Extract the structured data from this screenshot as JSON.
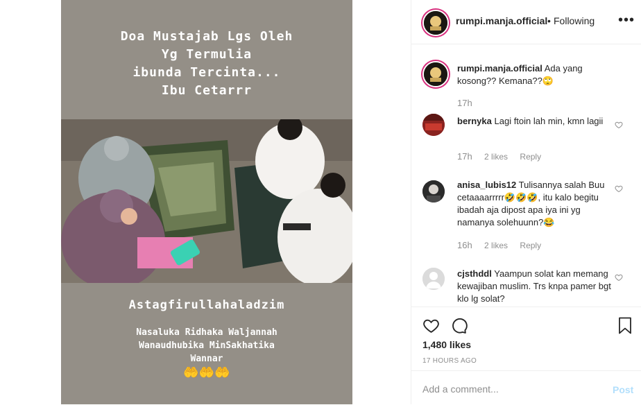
{
  "story": {
    "caption_lines": [
      "Doa Mustajab Lgs Oleh",
      "Yg Termulia",
      "ibunda Tercinta...",
      "Ibu Cetarrr"
    ],
    "headline": "Astagfirullahaladzim",
    "prayer_lines": [
      "Nasaluka Ridhaka Waljannah",
      "Wanaudhubika MinSakhatika",
      "Wannar"
    ],
    "hands_emoji": "🤲🤲🤲"
  },
  "header": {
    "username": "rumpi.manja.official",
    "separator": "•",
    "follow_status": "Following",
    "more": "•••"
  },
  "comments": [
    {
      "user": "rumpi.manja.official",
      "text": "Ada yang kosong?? Kemana??🙄",
      "time": "17h",
      "likes": "",
      "reply": ""
    },
    {
      "user": "bernyka",
      "text": "Lagi ftoin lah min, kmn lagii",
      "time": "17h",
      "likes": "2 likes",
      "reply": "Reply"
    },
    {
      "user": "anisa_lubis12",
      "text": "Tulisannya salah Buu cetaaaarrrrr🤣🤣🤣, itu kalo begitu ibadah aja dipost apa iya ini yg namanya solehuunn?😂",
      "time": "16h",
      "likes": "2 likes",
      "reply": "Reply"
    },
    {
      "user": "cjsthddl",
      "text": "Yaampun solat kan memang kewajiban muslim. Trs knpa pamer bgt klo lg solat?",
      "time": "",
      "likes": "",
      "reply": ""
    }
  ],
  "actions": {
    "likes": "1,480 likes",
    "time_ago": "17 HOURS AGO"
  },
  "add_comment": {
    "placeholder": "Add a comment...",
    "post_label": "Post"
  },
  "colors": {
    "story_bg": "#948f87",
    "story_ring": "#d8307f",
    "post_disabled": "#b2dffc"
  }
}
